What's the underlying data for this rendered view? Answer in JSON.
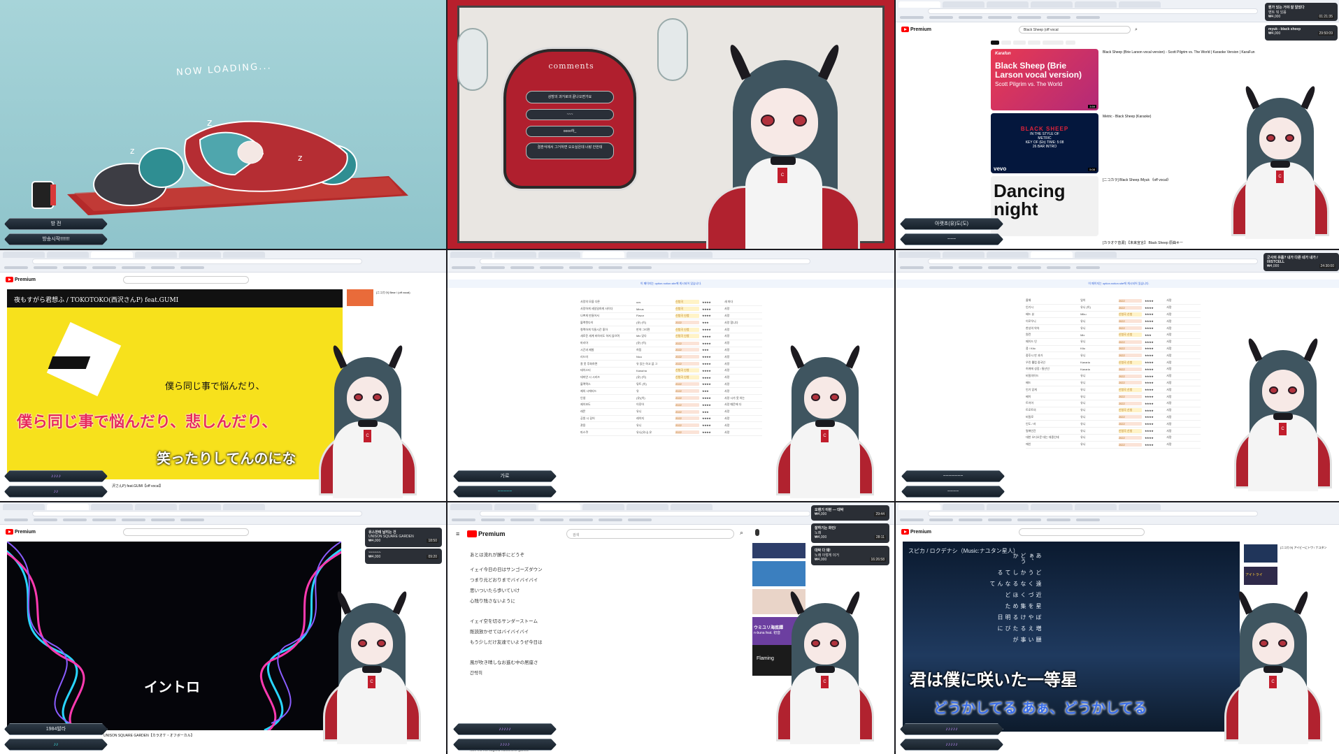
{
  "panels": {
    "p1": {
      "loading_text": "NOW LOADING...",
      "box1": "방 전",
      "box2": "방송시작!!!!!!!"
    },
    "p2": {
      "title": "comments",
      "options": [
        "상방의 과거로의 끝나오면가요",
        "~~~",
        "oooo하_",
        "결혼식에서 그거하면 오오싶은데 너랑 안한데"
      ]
    },
    "p3": {
      "search_query": "Black Sheep (off vocal",
      "chat1": {
        "title": "뭔가 있는 거야 잘 알았다",
        "sub": "멘트 뭐 있음",
        "price": "₩4,000",
        "time": "01:21:35"
      },
      "chat2": {
        "title": "myuk - black sheep",
        "price": "₩4,000",
        "time": "29:50:09"
      },
      "results": [
        {
          "thumb_brand": "Karafun",
          "thumb_title": "Black Sheep (Brie Larson vocal version)",
          "thumb_sub": "Scott Pilgrim vs. The World",
          "title": "Black Sheep (Brie Larson vocal version) - Scott Pilgrim vs. The World | Karaoke Version | KaraFun",
          "duration": "3:59"
        },
        {
          "thumb_big": "BLACK SHEEP",
          "thumb_lines": [
            "IN THE STYLE OF",
            "METRIC",
            "KEY OF (Eb)   TIME: 5:08",
            "26 BAR INTRO"
          ],
          "thumb_brand": "vevo",
          "title": "Metric - Black Sheep (Karaoke)",
          "duration": "5:08"
        },
        {
          "thumb_big": "Dancing night",
          "title": "[ニコカラ] Black Sheep /Myuk 《off vocal》"
        },
        {
          "title": "[カラオケ音源] 【未来宣言】 Black Sheep 原曲キー"
        }
      ],
      "box1": "아랫초(유)도(도)",
      "box2": "~~~"
    },
    "p4": {
      "title_overlay": "夜もすがら君想ふ / TOKOTOKO(西沢さんP) feat.GUMI",
      "lyric_small": "僕ら同じ事で悩んだり、",
      "lyric_main": "僕ら同じ事で悩んだり、悲しんだり、",
      "lyric_next": "笑ったりしてんのにな",
      "video_caption": "沢さんP) feat.GUMI【off vocal】",
      "side_title": "[ニコカラ] Bear / (off vocal)",
      "box1": "♪♪♪♪",
      "box2": "♪♪"
    },
    "p5": {
      "notice": "이 페이지는 option.notion.site에 게시되어 있습니다.",
      "rows": [
        [
          "사랑의 모을 다른",
          "ucs",
          "신청곡",
          "★★★★",
          "새 마다"
        ],
        [
          "사랑하게 세일일하게 사이다",
          "Minus",
          "신청곡",
          "★★★★",
          "사랑"
        ],
        [
          "나쁘게 만들어서",
          "Flavor",
          "신청곡 신청",
          "★★★★",
          "사랑"
        ],
        [
          "블랙캣다이",
          "(유)·(이)",
          "2022",
          "★★★",
          "사랑 합니다"
        ],
        [
          "컬렉하게 익들시간 좋아",
          "만약 그리면",
          "신청곡 신청",
          "★★★★",
          "사랑"
        ],
        [
          "새로운 세계 비하지도 하지 않으며",
          "Mix 있다",
          "신청곡 신청",
          "★★★★",
          "사랑"
        ],
        [
          "마리아",
          "(유)·(이)",
          "2022",
          "★★★★",
          "사랑"
        ],
        [
          "시간과 제발",
          "허밍",
          "2022",
          "★★★",
          "사랑"
        ],
        [
          "리드미",
          "Nico",
          "2022",
          "★★★★",
          "사랑"
        ],
        [
          "잘 못 후회하면",
          "유 있는 하고 없 그",
          "2022",
          "★★★★",
          "사랑"
        ],
        [
          "테이스티",
          "Kana/na",
          "신청곡 신청",
          "★★★★",
          "사랑"
        ],
        [
          "데미안 시 시리즈",
          "(유)·(이)",
          "신청곡 신청",
          "★★★★",
          "사랑"
        ],
        [
          "블랙맥스",
          "뮤트 (이)",
          "2022",
          "★★★★",
          "사랑"
        ],
        [
          "제의 시에티드",
          "유",
          "2022",
          "★★★",
          "사랑"
        ],
        [
          "인생",
          "(유)(이)",
          "2022",
          "★★★★",
          "사랑 시가 못 하는"
        ],
        [
          "제이보도",
          "이루어",
          "2022",
          "★★★★",
          "사랑 때문에 다"
        ],
        [
          "레몬",
          "유니",
          "2022",
          "★★★",
          "사랑"
        ],
        [
          "공원 시 길어",
          "레이지",
          "2022",
          "★★★★",
          "사랑"
        ],
        [
          "관용",
          "유니",
          "2022",
          "★★★★",
          "사랑"
        ],
        [
          "마스쿠",
          "유니(유니) 유",
          "2022",
          "★★★★",
          "사랑"
        ]
      ],
      "box1": "가로",
      "box2": "~~~~~"
    },
    "p6": {
      "notice": "이 페이지는 option.notion.site에 게시되어 있습니다.",
      "chat1": {
        "title": "군사의 유품? 내가 다른 네가 내가 / 00STCELL",
        "price": "₩4,000",
        "time": "24:30:00"
      },
      "rows": [
        [
          "올해",
          "일이",
          "2022",
          "★★★★",
          "사랑"
        ],
        [
          "인기시",
          "유니 (이)",
          "2022",
          "★★★★",
          "사랑"
        ],
        [
          "배드 뷰",
          "Miku",
          "신청곡 신청",
          "★★★★",
          "사랑"
        ],
        [
          "이로우니",
          "유니",
          "2022",
          "★★★★",
          "사랑"
        ],
        [
          "한성의 약속",
          "유니",
          "2022",
          "★★★★",
          "사랑"
        ],
        [
          "원컨",
          "Mix",
          "신청곡 신청",
          "★★★",
          "사랑"
        ],
        [
          "메이드 인",
          "유니",
          "2022",
          "★★★★",
          "사랑"
        ],
        [
          "쿵 / Kito",
          "Kito",
          "2022",
          "★★★★",
          "사랑"
        ],
        [
          "중후시 만 과거",
          "유니",
          "2022",
          "★★★★",
          "사랑"
        ],
        [
          "우린 웰컴 중국인",
          "Kanaria",
          "신청곡 신청",
          "★★★★",
          "사랑"
        ],
        [
          "허게에 성장 / 통산인",
          "Kanaria",
          "2022",
          "★★★★",
          "사랑"
        ],
        [
          "비밀의이드",
          "유니",
          "2022",
          "★★★★",
          "사랑"
        ],
        [
          "배드",
          "유니",
          "2022",
          "★★★★",
          "사랑"
        ],
        [
          "인기 있게",
          "유니",
          "신청곡 신청",
          "★★★★",
          "사랑"
        ],
        [
          "베이",
          "유니",
          "2022",
          "★★★★",
          "사랑"
        ],
        [
          "트이어",
          "유니",
          "2022",
          "★★★★",
          "사랑"
        ],
        [
          "트로트의",
          "유니",
          "신청곡 신청",
          "★★★★",
          "사랑"
        ],
        [
          "비밀로",
          "유니",
          "2022",
          "★★★★",
          "사랑"
        ],
        [
          "인도 / 러",
          "유니",
          "2022",
          "★★★★",
          "사랑"
        ],
        [
          "밀애인간",
          "유니",
          "신청곡 신청",
          "★★★★",
          "사랑"
        ],
        [
          "대한 오디오문 대는 대중인데",
          "유니",
          "2022",
          "★★★★",
          "사랑"
        ],
        [
          "애인",
          "유니",
          "2022",
          "★★★★",
          "사랑"
        ]
      ],
      "box1": "~~~~~~~",
      "box2": "~~~~"
    },
    "p7": {
      "intro_text": "イントロ",
      "video_caption": "UNISON SQUARE GARDEN【カラオケ・オフボーカル】",
      "chat1": {
        "title": "유스한테 날리는 건",
        "sub": "UNISON SQUARE GARDEN",
        "price": "₩4,000",
        "time": "18:50"
      },
      "chat2": {
        "title": "~~~~~~",
        "price": "₩4,000",
        "time": "09:20"
      },
      "box1": "1984발라",
      "box2": "♪♪"
    },
    "p8": {
      "search_placeholder": "검색",
      "lyrics": [
        "あとは流れが勝手にどうぞ",
        "",
        "イェイ今日の日はサンゴーズダウン",
        "つまり元どおりまでバイバイバイ",
        "思いついたら歩いていけ",
        "心残り残さないように",
        "",
        "イェイ空を切るサンダーストーム",
        "既読放かせてはバイバイバイ",
        "もう少しだけ友達でいようぜ今日は",
        "",
        "風が吹き晴しなお進む中の居座さ",
        "간략히"
      ],
      "footer": "Nee mo mo sugoku hatoshimo ganow",
      "chat1": {
        "title": "오랜기 이런 — 대박",
        "price": "₩4,000",
        "time": "29:44"
      },
      "chat2": {
        "title": "잘하기는 화인/",
        "sub": "노래",
        "price": "₩4,000",
        "time": "28:11"
      },
      "chat3": {
        "title": "대박 다 돼!",
        "sub": "노래 이렇게 이거",
        "price": "₩4,000",
        "time": "16:26:58"
      },
      "side": [
        "ウミユリ海底譚",
        "n-buna feat. 初音",
        "Flaming"
      ],
      "box1": "♪♪♪♪♪",
      "box2": "♪♪♪♪"
    },
    "p9": {
      "title_overlay": "スピカ / ロクデナシ（Music:ナユタン星人）",
      "vertical_lyrics": [
        "願い事が",
        "増えるたびに",
        "ぼやける明日",
        "星を集めた",
        "近づくほど",
        "遠くなるなんて",
        "どうかしてる",
        "あぁ、どうか"
      ],
      "lyric_main": "君は僕に咲いた一等星",
      "lyric_next": "どうかしてる  あぁ、どうかしてる",
      "side": [
        "[ニコカラ] アイビーにトワ / ナユタン",
        "アイトライ"
      ],
      "box1": "♪♪♪♪♪",
      "box2": "♪♪♪♪♪"
    }
  },
  "colors": {
    "yt_red": "#ff0000",
    "teal_bg": "#a6d3d8",
    "chinese_red": "#b31d2b",
    "karaoke_yellow": "#f7e11c",
    "karaoke_pink": "#e72a5c",
    "karaoke_blue": "#2356c9"
  }
}
